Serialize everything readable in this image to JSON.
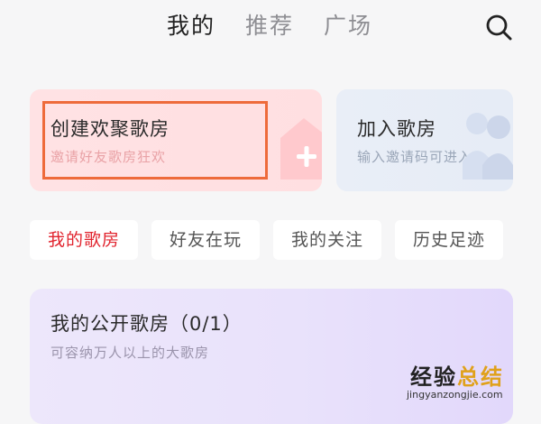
{
  "top_tabs": [
    {
      "label": "我的",
      "active": true
    },
    {
      "label": "推荐",
      "active": false
    },
    {
      "label": "广场",
      "active": false
    }
  ],
  "search_icon": "search-icon",
  "create_card": {
    "title": "创建欢聚歌房",
    "subtitle": "邀请好友歌房狂欢",
    "icon": "house-plus-icon"
  },
  "join_card": {
    "title": "加入歌房",
    "subtitle": "输入邀请码可进入",
    "icon": "people-icon"
  },
  "sub_tabs": [
    {
      "label": "我的歌房",
      "active": true
    },
    {
      "label": "好友在玩",
      "active": false
    },
    {
      "label": "我的关注",
      "active": false
    },
    {
      "label": "历史足迹",
      "active": false
    }
  ],
  "room_card": {
    "title": "我的公开歌房（0/1）",
    "subtitle": "可容纳万人以上的大歌房"
  },
  "watermark": {
    "part1": "经验",
    "part2": "总结",
    "url": "jingyanzongjie.com"
  },
  "colors": {
    "active_red": "#e1242e",
    "highlight_orange": "#ee6b3b",
    "create_bg": "#ffe2e4",
    "join_bg": "#e9eef7",
    "room_bg": "#ede7fb"
  }
}
